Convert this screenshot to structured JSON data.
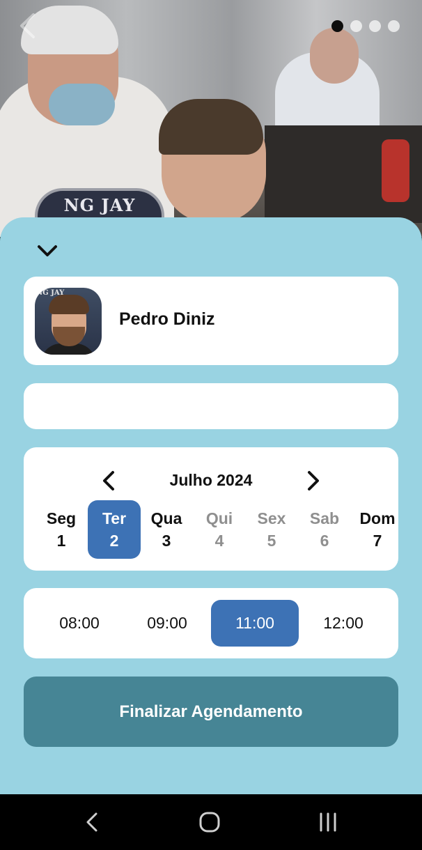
{
  "hero": {
    "poster_text": "NG JAY",
    "carousel_total": 4,
    "carousel_active": 1
  },
  "barber": {
    "name": "Pedro Diniz",
    "avatar_caption": "NG JAY"
  },
  "calendar": {
    "month_label": "Julho 2024",
    "days": [
      {
        "weekday": "Seg",
        "day": "1",
        "state": "available"
      },
      {
        "weekday": "Ter",
        "day": "2",
        "state": "selected"
      },
      {
        "weekday": "Qua",
        "day": "3",
        "state": "available"
      },
      {
        "weekday": "Qui",
        "day": "4",
        "state": "disabled"
      },
      {
        "weekday": "Sex",
        "day": "5",
        "state": "disabled"
      },
      {
        "weekday": "Sab",
        "day": "6",
        "state": "disabled"
      },
      {
        "weekday": "Dom",
        "day": "7",
        "state": "available"
      }
    ]
  },
  "times": {
    "slots": [
      "08:00",
      "09:00",
      "11:00",
      "12:00"
    ],
    "selected": "11:00"
  },
  "actions": {
    "finish_label": "Finalizar Agendamento"
  },
  "colors": {
    "sheet_bg": "#99d3e2",
    "accent": "#3d72b5",
    "finish_button": "#468595"
  },
  "icons": {
    "back": "chevron-left-icon",
    "collapse": "chevron-down-icon",
    "month_prev": "chevron-left-icon",
    "month_next": "chevron-right-icon"
  }
}
